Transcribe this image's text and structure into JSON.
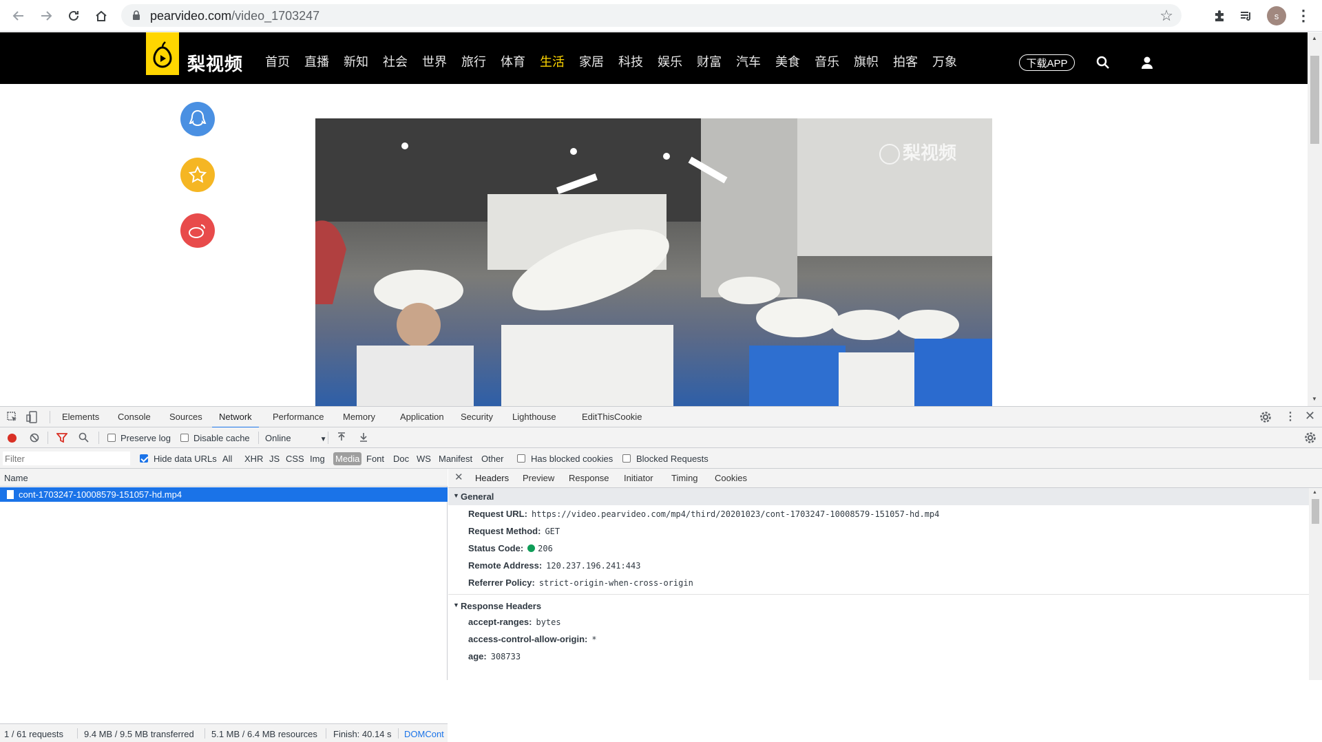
{
  "browser": {
    "url_host": "pearvideo.com",
    "url_path": "/video_1703247",
    "profile_initial": "s"
  },
  "site": {
    "logo_text": "梨视频",
    "nav": [
      "首页",
      "直播",
      "新知",
      "社会",
      "世界",
      "旅行",
      "体育",
      "生活",
      "家居",
      "科技",
      "娱乐",
      "财富",
      "汽车",
      "美食",
      "音乐",
      "旗帜",
      "拍客",
      "万象"
    ],
    "active_nav": "生活",
    "download_app": "下载APP",
    "watermark": "梨视频"
  },
  "devtools": {
    "tabs": [
      "Elements",
      "Console",
      "Sources",
      "Network",
      "Performance",
      "Memory",
      "Application",
      "Security",
      "Lighthouse",
      "EditThisCookie"
    ],
    "active_tab": "Network",
    "toolbar": {
      "preserve_log": "Preserve log",
      "disable_cache": "Disable cache",
      "throttle": "Online"
    },
    "filter": {
      "placeholder": "Filter",
      "hide_data_urls": "Hide data URLs",
      "types": [
        "All",
        "XHR",
        "JS",
        "CSS",
        "Img",
        "Media",
        "Font",
        "Doc",
        "WS",
        "Manifest",
        "Other"
      ],
      "active_type": "Media",
      "has_blocked_cookies": "Has blocked cookies",
      "blocked_requests": "Blocked Requests"
    },
    "list": {
      "column_name": "Name",
      "rows": [
        "cont-1703247-10008579-151057-hd.mp4"
      ]
    },
    "status_bar": {
      "requests": "1 / 61 requests",
      "transferred": "9.4 MB / 9.5 MB transferred",
      "resources": "5.1 MB / 6.4 MB resources",
      "finish": "Finish: 40.14 s",
      "domcontent": "DOMCont"
    },
    "detail_tabs": [
      "Headers",
      "Preview",
      "Response",
      "Initiator",
      "Timing",
      "Cookies"
    ],
    "active_detail_tab": "Headers",
    "general": {
      "title": "General",
      "request_url_label": "Request URL:",
      "request_url": "https://video.pearvideo.com/mp4/third/20201023/cont-1703247-10008579-151057-hd.mp4",
      "request_method_label": "Request Method:",
      "request_method": "GET",
      "status_code_label": "Status Code:",
      "status_code": "206",
      "remote_address_label": "Remote Address:",
      "remote_address": "120.237.196.241:443",
      "referrer_policy_label": "Referrer Policy:",
      "referrer_policy": "strict-origin-when-cross-origin"
    },
    "response_headers": {
      "title": "Response Headers",
      "accept_ranges_label": "accept-ranges:",
      "accept_ranges": "bytes",
      "acao_label": "access-control-allow-origin:",
      "acao": "*",
      "age_label": "age:",
      "age": "308733"
    }
  }
}
